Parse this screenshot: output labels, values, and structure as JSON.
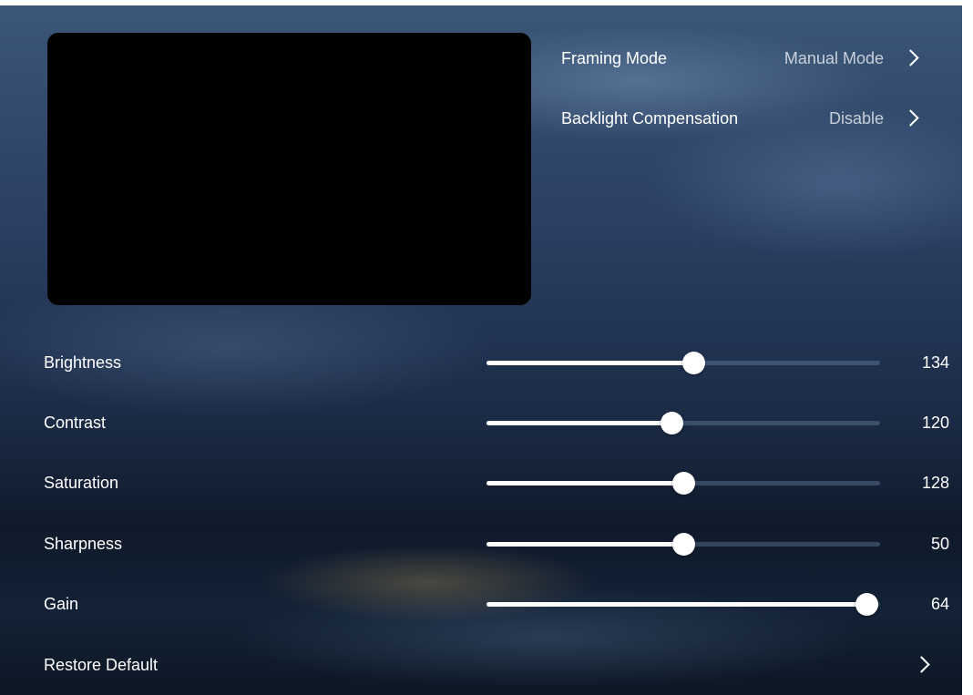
{
  "settings": [
    {
      "label": "Framing Mode",
      "value": "Manual Mode",
      "icon": "chevron-right-icon"
    },
    {
      "label": "Backlight Compensation",
      "value": "Disable",
      "icon": "chevron-right-icon"
    }
  ],
  "sliders": [
    {
      "label": "Brightness",
      "value": "134",
      "fill_fraction": 0.525
    },
    {
      "label": "Contrast",
      "value": "120",
      "fill_fraction": 0.47
    },
    {
      "label": "Saturation",
      "value": "128",
      "fill_fraction": 0.5
    },
    {
      "label": "Sharpness",
      "value": "50",
      "fill_fraction": 0.5
    },
    {
      "label": "Gain",
      "value": "64",
      "fill_fraction": 0.965
    }
  ],
  "restore": {
    "label": "Restore Default",
    "icon": "chevron-right-icon"
  },
  "colors": {
    "accent": "#ffffff",
    "track": "#5a7591",
    "preview": "#000000"
  }
}
